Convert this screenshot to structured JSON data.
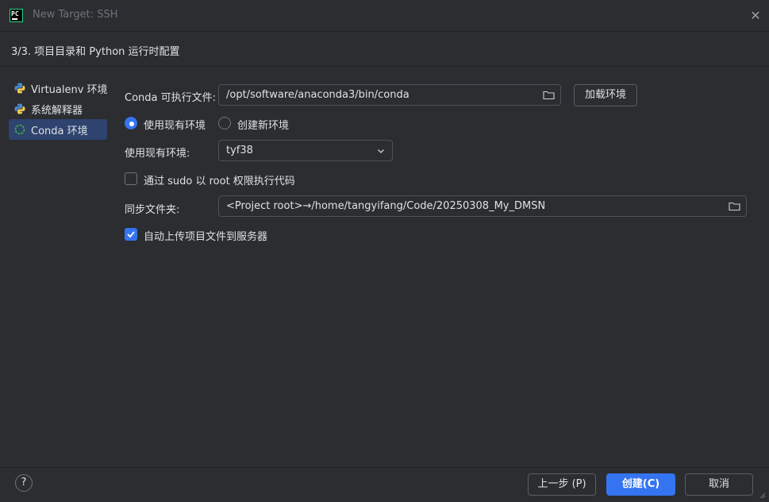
{
  "window": {
    "title": "New Target: SSH",
    "close_icon": "close-icon"
  },
  "step": {
    "title": "3/3. 项目目录和 Python 运行时配置"
  },
  "sidebar": {
    "items": [
      {
        "label": "Virtualenv 环境",
        "icon": "python-icon",
        "selected": false
      },
      {
        "label": "系统解释器",
        "icon": "python-icon",
        "selected": false
      },
      {
        "label": "Conda 环境",
        "icon": "conda-icon",
        "selected": true
      }
    ]
  },
  "form": {
    "conda_exec": {
      "label": "Conda 可执行文件:",
      "value": "/opt/software/anaconda3/bin/conda"
    },
    "load_env_button": "加载环境",
    "radio_existing": {
      "label": "使用现有环境",
      "checked": true
    },
    "radio_new": {
      "label": "创建新环境",
      "checked": false
    },
    "existing_env": {
      "label": "使用现有环境:",
      "value": "tyf38"
    },
    "sudo": {
      "label": "通过 sudo 以 root 权限执行代码",
      "checked": false
    },
    "sync_folder": {
      "label": "同步文件夹:",
      "value": "<Project root>→/home/tangyifang/Code/20250308_My_DMSN"
    },
    "auto_upload": {
      "label": "自动上传项目文件到服务器",
      "checked": true
    }
  },
  "footer": {
    "help": "?",
    "prev_button": "上一步 (P)",
    "create_button": "创建(C)",
    "cancel_button": "取消"
  },
  "colors": {
    "accent": "#3574f0",
    "background": "#2b2d30",
    "text": "#dfe1e5",
    "muted": "#6f737a"
  }
}
